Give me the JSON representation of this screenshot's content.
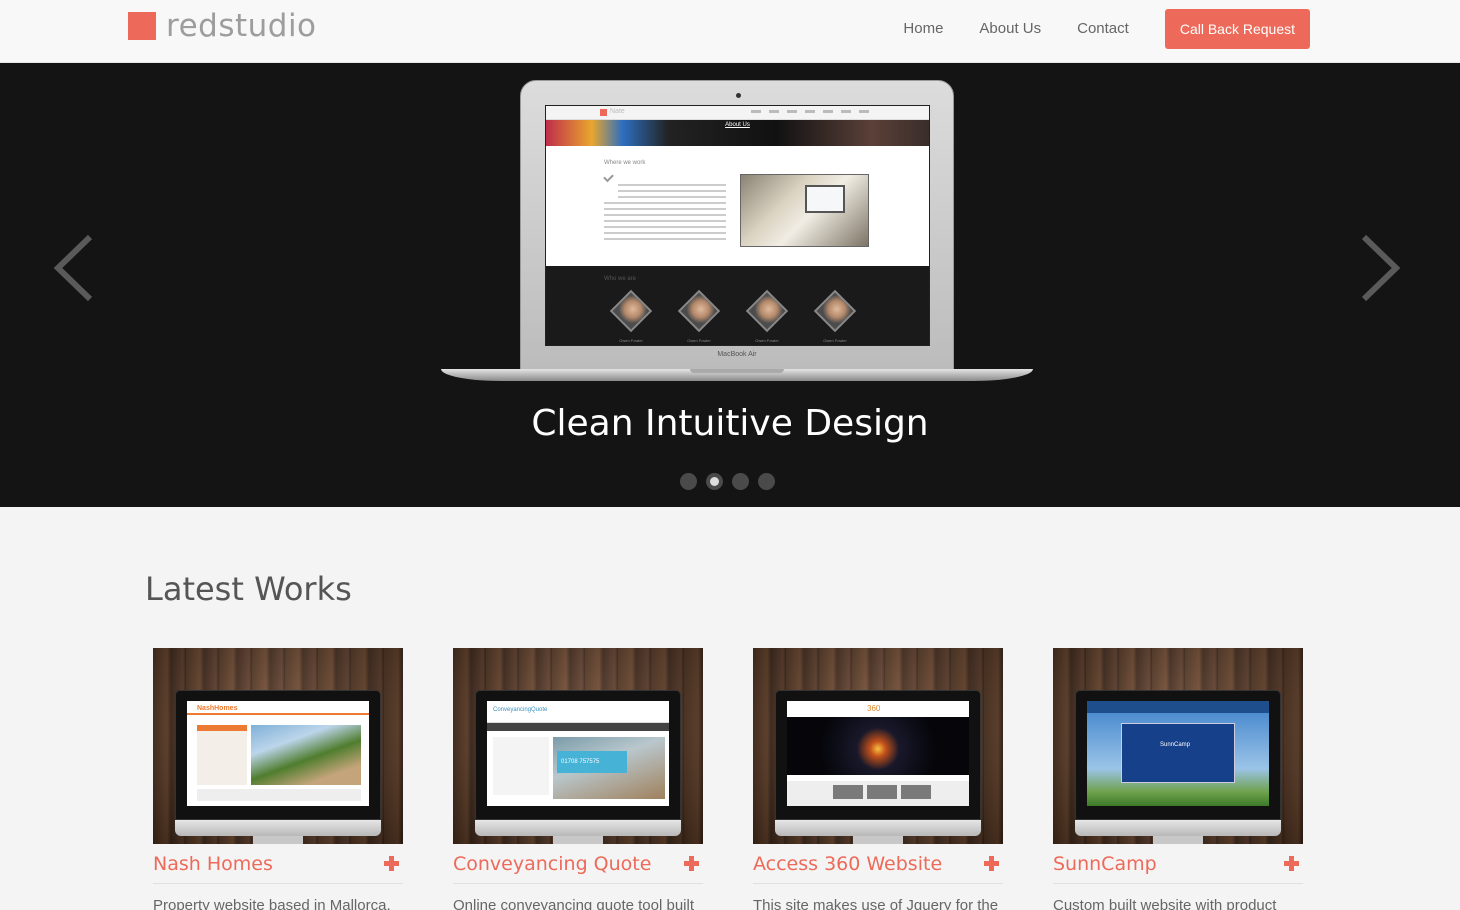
{
  "header": {
    "logo_text": "redstudio",
    "nav": [
      "Home",
      "About Us",
      "Contact"
    ],
    "cta_label": "Call Back Request"
  },
  "hero": {
    "caption": "Clean Intuitive Design",
    "slide_count": 4,
    "active_slide": 2,
    "laptop_brand": "MacBook Air",
    "screen": {
      "logo": "Nate",
      "banner_title": "About Us",
      "section_heading": "Where we work",
      "team_heading": "Who we are",
      "team_caption": "Owen Fowler"
    },
    "prev_icon": "chevron-left-icon",
    "next_icon": "chevron-right-icon"
  },
  "works": {
    "title": "Latest Works",
    "items": [
      {
        "title": "Nash Homes",
        "description": "Property website based in Mallorca,",
        "screen_logo": "NashHomes"
      },
      {
        "title": "Conveyancing Quote",
        "description": "Online conveyancing quote tool built",
        "screen_logo": "ConveyancingQuote",
        "screen_phone": "01708 757575"
      },
      {
        "title": "Access 360 Website",
        "description": "This site makes use of Jquery for the",
        "screen_logo": "360"
      },
      {
        "title": "SunnCamp",
        "description": "Custom built website with product",
        "screen_logo": "SunnCamp"
      }
    ]
  },
  "colors": {
    "accent": "#ed6a5a",
    "hero_bg": "#141414",
    "page_bg": "#f4f4f4"
  }
}
